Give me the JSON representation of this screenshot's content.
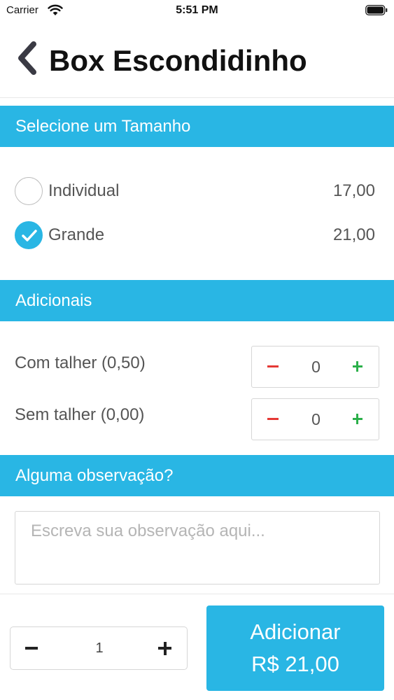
{
  "status_bar": {
    "carrier": "Carrier",
    "time": "5:51 PM"
  },
  "header": {
    "title": "Box Escondidinho"
  },
  "sections": {
    "size": "Selecione um Tamanho",
    "addons": "Adicionais",
    "observation": "Alguma observação?"
  },
  "sizes": [
    {
      "label": "Individual",
      "price": "17,00",
      "selected": false
    },
    {
      "label": "Grande",
      "price": "21,00",
      "selected": true
    }
  ],
  "addons": [
    {
      "label": "Com talher (0,50)",
      "quantity": "0"
    },
    {
      "label": "Sem talher (0,00)",
      "quantity": "0"
    }
  ],
  "observation": {
    "placeholder": "Escreva sua observação aqui...",
    "value": ""
  },
  "footer": {
    "quantity": "1",
    "add_label": "Adicionar",
    "add_total": "R$ 21,00"
  },
  "colors": {
    "accent": "#29b6e4",
    "minus": "#e53935",
    "plus": "#2bb04a"
  },
  "icons": [
    "wifi-icon",
    "battery-icon",
    "chevron-left-icon",
    "checkmark-icon"
  ]
}
